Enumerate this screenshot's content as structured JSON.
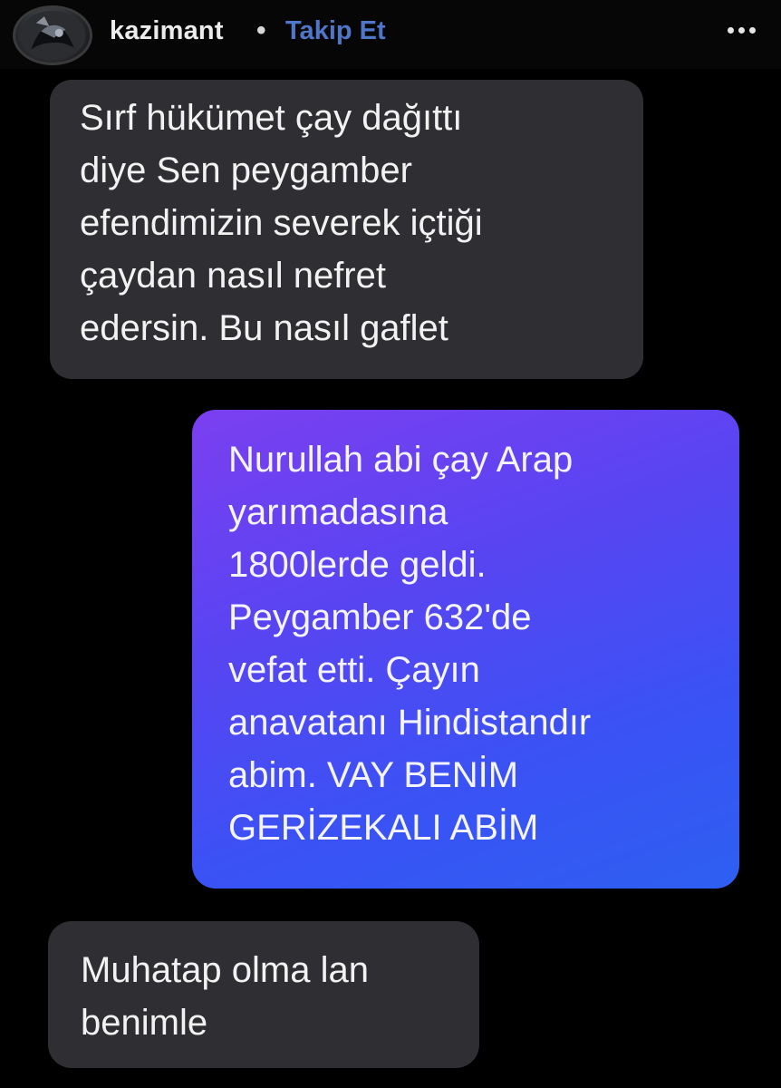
{
  "header": {
    "username": "kazimant",
    "separator": "•",
    "follow_label": "Takip Et",
    "more_icon": "more-horizontal-icon",
    "avatar_icon": "profile-avatar"
  },
  "messages": [
    {
      "sender": "other",
      "text": "Sırf hükümet çay dağıttı\ndiye Sen peygamber\nefendimizin severek içtiği\nçaydan nasıl nefret\nedersin. Bu nasıl gaflet"
    },
    {
      "sender": "me",
      "text": "Nurullah abi çay Arap\nyarımadasına\n1800lerde geldi.\nPeygamber 632'de\nvefat etti. Çayın\nanavatanı Hindistandır\nabim. VAY BENİM\nGERİZEKALI ABİM"
    },
    {
      "sender": "other",
      "text": "Muhatap olma lan\nbenimle"
    }
  ],
  "colors": {
    "background": "#000000",
    "incoming_bubble": "#2f2f33",
    "outgoing_gradient_start": "#7b3ff0",
    "outgoing_gradient_end": "#2e5ff2",
    "follow_link": "#4f76c8"
  }
}
